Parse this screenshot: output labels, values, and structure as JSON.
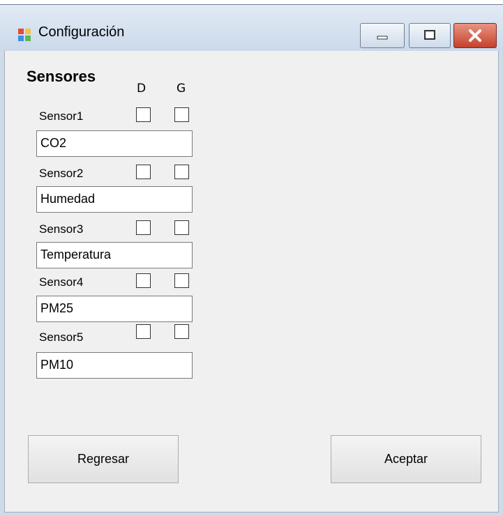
{
  "window": {
    "title": "Configuración"
  },
  "section": {
    "heading": "Sensores",
    "col_d": "D",
    "col_g": "G"
  },
  "sensors": [
    {
      "label": "Sensor1",
      "value": "CO2",
      "d_checked": false,
      "g_checked": false
    },
    {
      "label": "Sensor2",
      "value": "Humedad",
      "d_checked": false,
      "g_checked": false
    },
    {
      "label": "Sensor3",
      "value": "Temperatura",
      "d_checked": false,
      "g_checked": false
    },
    {
      "label": "Sensor4",
      "value": "PM25",
      "d_checked": false,
      "g_checked": false
    },
    {
      "label": "Sensor5",
      "value": "PM10",
      "d_checked": false,
      "g_checked": false
    }
  ],
  "buttons": {
    "back": "Regresar",
    "accept": "Aceptar"
  }
}
